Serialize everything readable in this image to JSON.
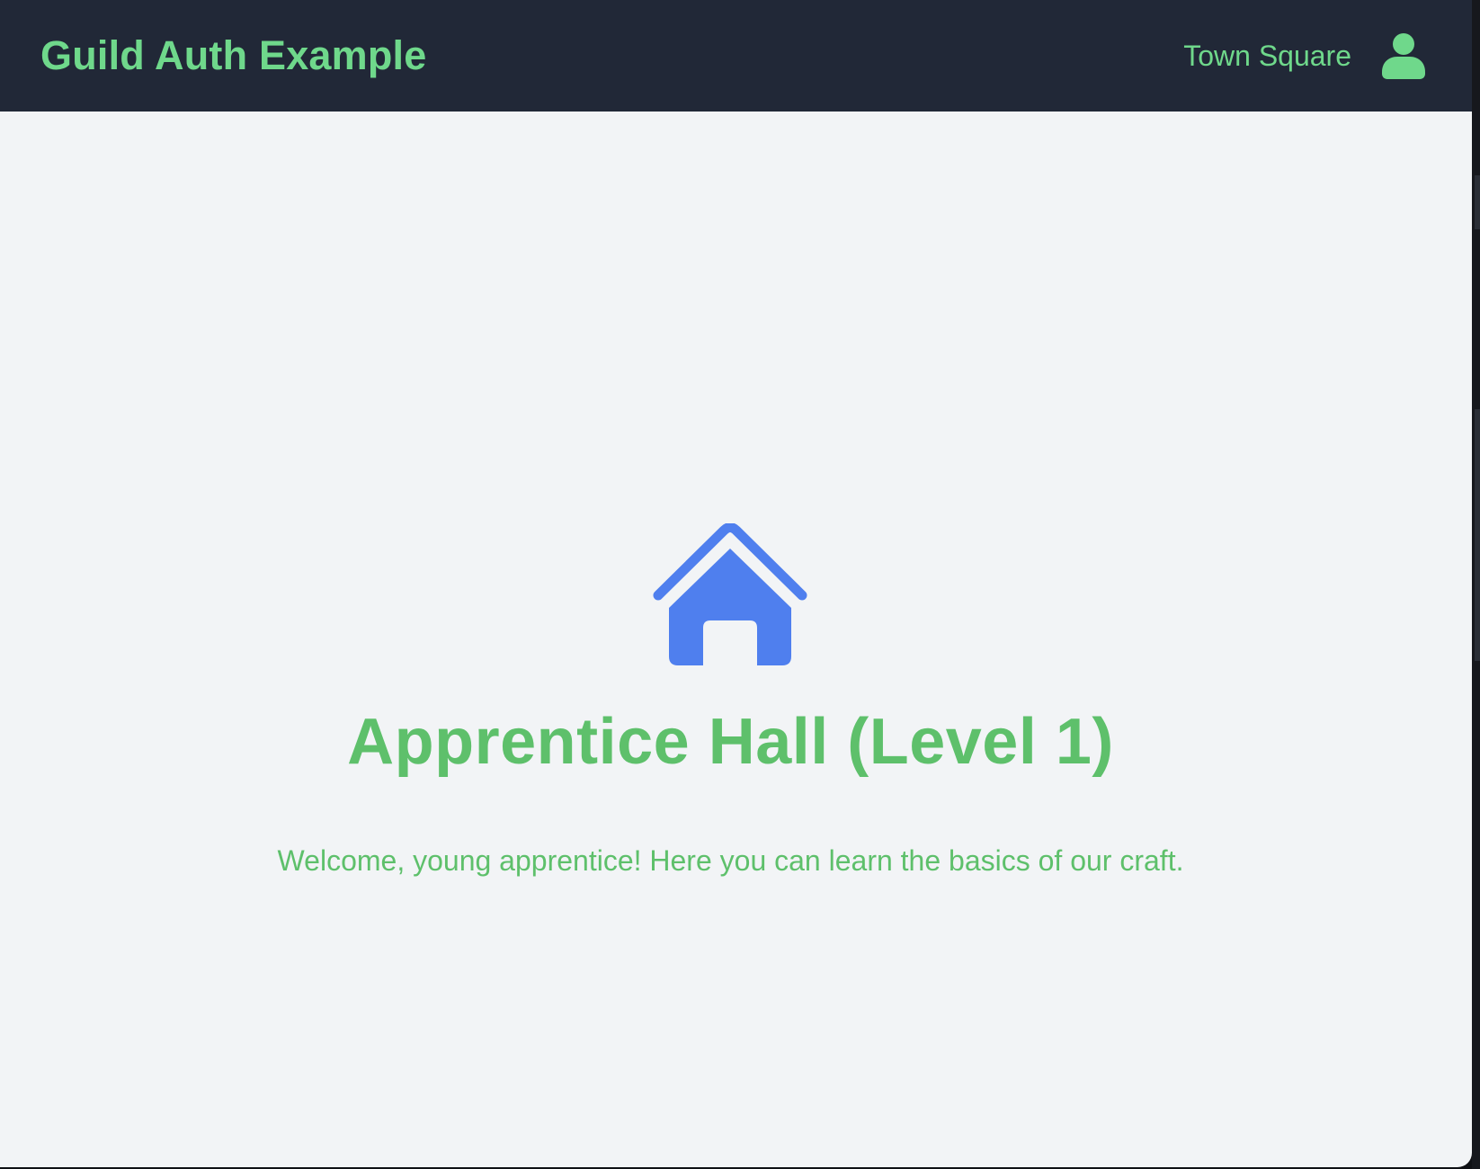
{
  "header": {
    "brand": "Guild Auth Example",
    "nav_link": "Town Square",
    "user_icon": "user-icon"
  },
  "main": {
    "icon": "house-icon",
    "title": "Apprentice Hall (Level 1)",
    "message": "Welcome, young apprentice! Here you can learn the basics of our craft."
  },
  "colors": {
    "header_bg": "#212837",
    "accent_green": "#6fd88b",
    "title_green": "#5ec06b",
    "icon_blue": "#4f7fee",
    "page_bg": "#f2f4f6"
  }
}
